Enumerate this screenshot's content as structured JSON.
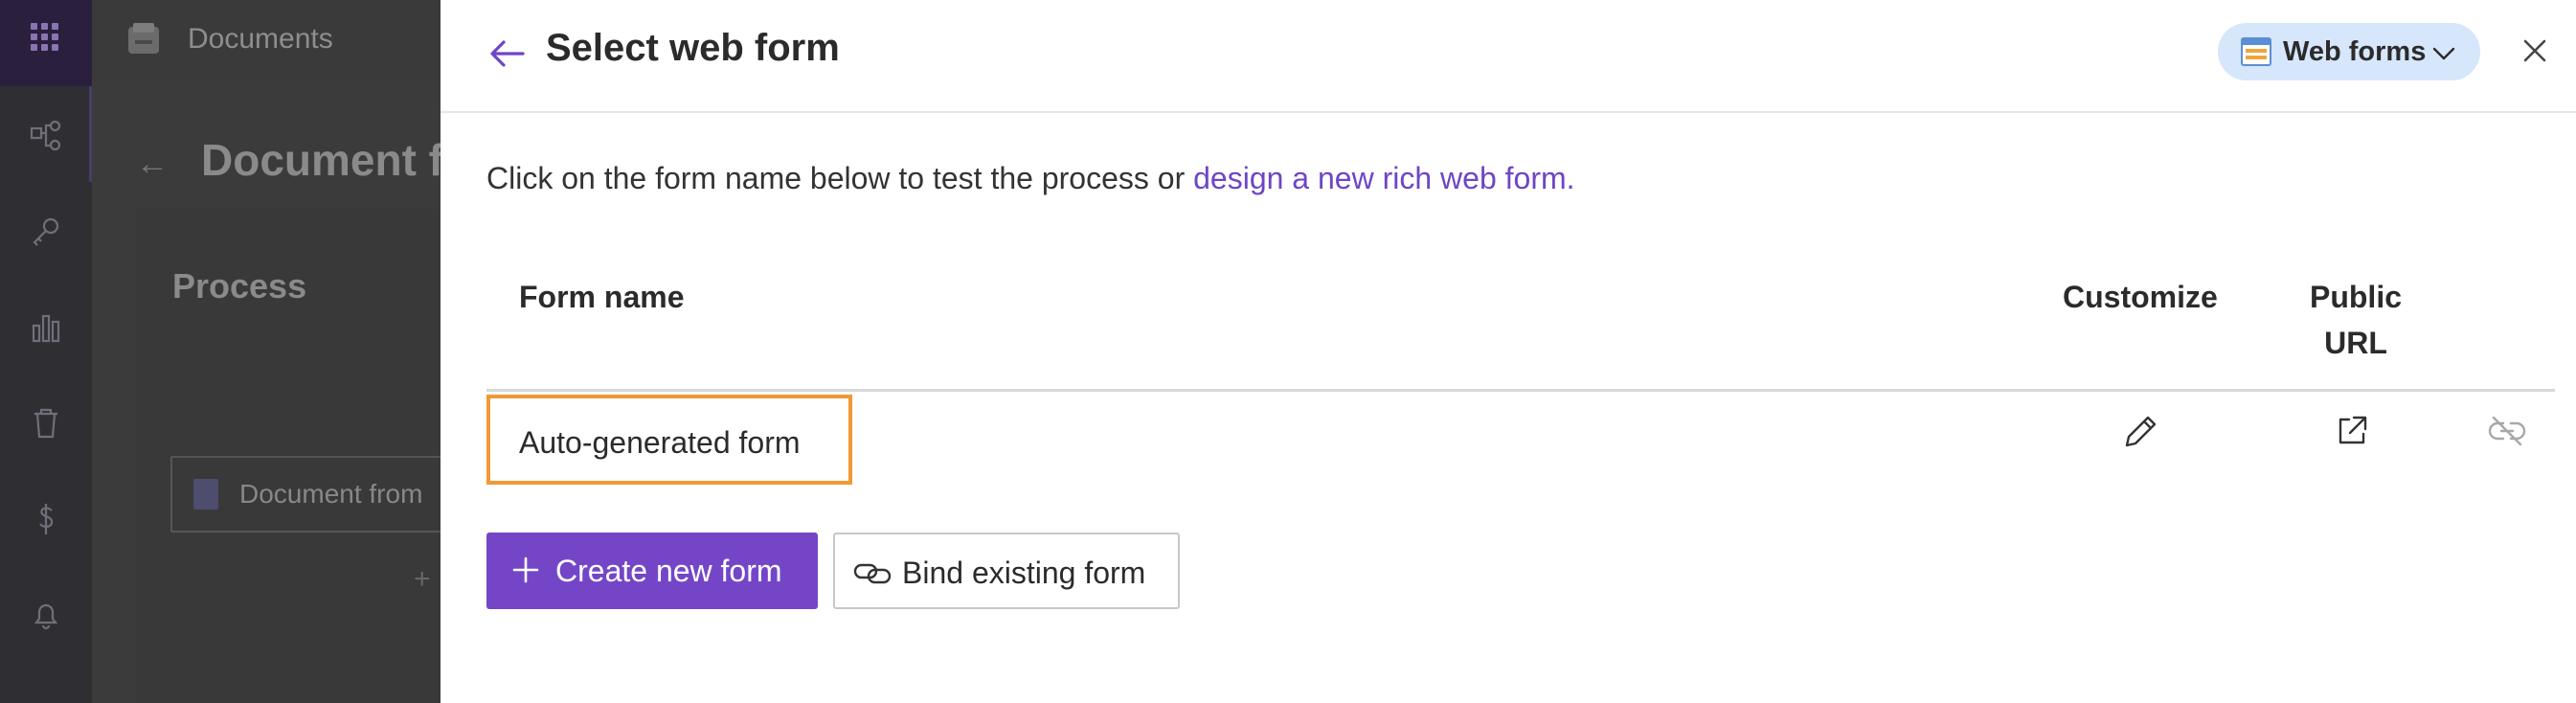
{
  "background_app": {
    "header_title": "Documents",
    "page_title": "Document f",
    "section_title": "Process",
    "document_item": "Document from"
  },
  "panel": {
    "title": "Select web form",
    "webforms_button": "Web forms",
    "intro_text": "Click on the form name below to test the process or ",
    "intro_link": "design a new rich web form."
  },
  "table": {
    "columns": {
      "form_name": "Form name",
      "customize": "Customize",
      "public_url_line1": "Public",
      "public_url_line2": "URL"
    },
    "rows": [
      {
        "form_name": "Auto-generated form"
      }
    ]
  },
  "actions": {
    "create_label": "Create new form",
    "bind_label": "Bind existing form"
  },
  "colors": {
    "accent": "#7446c7",
    "link": "#6e45c5",
    "highlight_border": "#f19a34",
    "webforms_bg": "#d6e6fb"
  }
}
